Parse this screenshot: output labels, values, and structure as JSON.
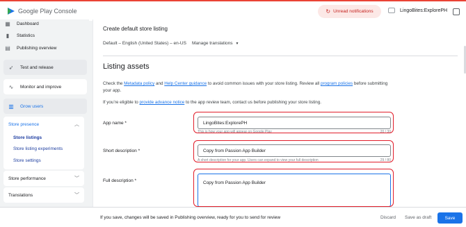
{
  "app": {
    "title": "Google Play Console"
  },
  "topbar": {
    "notifications_label": "Unread notifications",
    "account_name": "LingoBites:ExplorePH"
  },
  "sidebar": {
    "top_items": [
      {
        "label": "Dashboard",
        "icon": "dashboard-icon"
      },
      {
        "label": "Statistics",
        "icon": "bar-chart-icon"
      },
      {
        "label": "Publishing overview",
        "icon": "publishing-icon"
      }
    ],
    "test_release": "Test and release",
    "monitor_improve": "Monitor and improve",
    "grow_users": "Grow users",
    "store_presence": {
      "label": "Store presence",
      "items": [
        "Store listings",
        "Store listing experiments",
        "Store settings"
      ]
    },
    "store_performance": "Store performance",
    "translations": "Translations"
  },
  "main": {
    "section_title": "Create default store listing",
    "language": "Default – English (United States) – en-US",
    "manage_translations": "Manage translations",
    "heading": "Listing assets",
    "para1": {
      "a": "Check the ",
      "l1": "Metadata policy",
      "b": " and ",
      "l2": "Help Center guidance",
      "c": " to avoid common issues with your store listing. Review all ",
      "l3": "program policies",
      "d": " before submitting your app."
    },
    "para2": {
      "a": "If you’re eligible to ",
      "l1": "provide advance notice",
      "b": " to the app review team, contact us before publishing your store listing."
    },
    "fields": {
      "app_name": {
        "label": "App name *",
        "value": "LingoBites:ExplorePH",
        "hint": "This is how your app will appear on Google Play",
        "count": "20 / 30"
      },
      "short_desc": {
        "label": "Short description *",
        "value": "Copy from Passion App Builder",
        "hint": "A short description for your app. Users can expand to view your full description",
        "count": "29 / 80"
      },
      "full_desc": {
        "label": "Full description *",
        "value": "Copy from Passion App Builder"
      }
    }
  },
  "bottom": {
    "message": "If you save, changes will be saved in Publishing overview, ready for you to send for review",
    "discard": "Discard",
    "save_draft": "Save as draft",
    "save": "Save"
  },
  "colors": {
    "accent": "#1a73e8",
    "highlight": "#e11d2a",
    "notify_bg": "#fce8e6"
  }
}
